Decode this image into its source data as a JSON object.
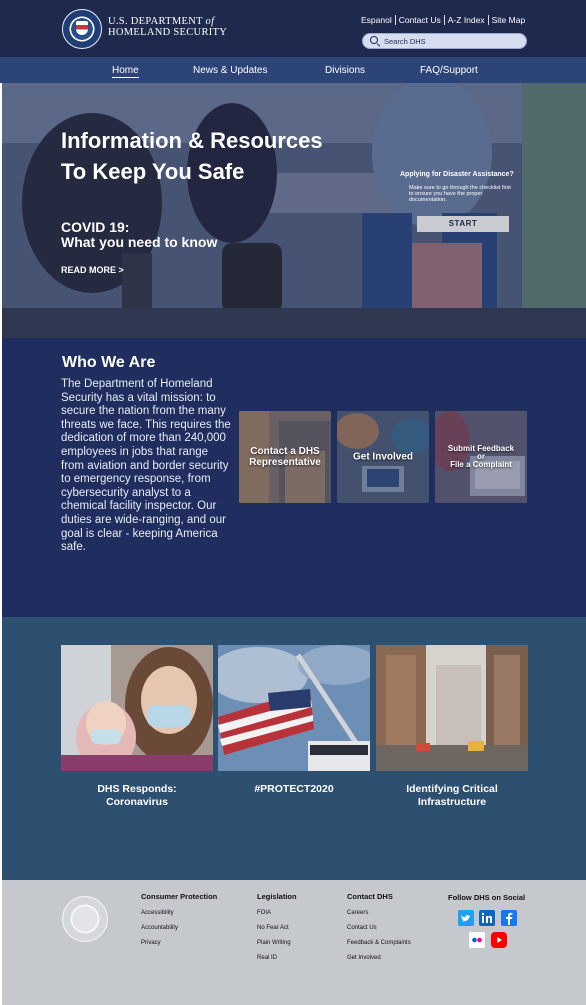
{
  "header": {
    "agency_line1": "U.S. DEPARTMENT",
    "agency_of": "of",
    "agency_line2": "HOMELAND SECURITY",
    "top_links": [
      "Espanol",
      "Contact Us",
      "A-Z Index",
      "Site Map"
    ],
    "search_placeholder": "Search DHS"
  },
  "nav": {
    "items": [
      "Home",
      "News & Updates",
      "Divisions",
      "FAQ/Support"
    ],
    "active": "Home"
  },
  "hero": {
    "title_line1": "Information & Resources",
    "title_line2": "To Keep You Safe",
    "covid_line1": "COVID 19:",
    "covid_line2": "What you need to know",
    "read_more": "READ MORE >",
    "assist_title": "Applying for Disaster Assistance?",
    "assist_body": "Make sure to go through the checklist first to ensure you have the proper documentation.",
    "start_label": "START"
  },
  "who": {
    "title": "Who We Are",
    "body": "The Department of Homeland Security has a vital mission: to secure the nation from the many threats we face.  This requires the dedication of more than 240,000 employees in jobs that range from aviation and border security to emergency response, from cybersecurity analyst to a chemical facility inspector.  Our duties are wide-ranging, and our goal is clear - keeping America safe.",
    "cards": [
      {
        "label_line1": "Contact a DHS",
        "label_line2": "Representative"
      },
      {
        "label_line1": "Get Involved"
      },
      {
        "label_line1": "Submit Feedback",
        "label_line2": "or",
        "label_line3": "File a Complaint"
      }
    ]
  },
  "stories": [
    {
      "label_line1": "DHS Responds:",
      "label_line2": "Coronavirus"
    },
    {
      "label_line1": "#PROTECT2020"
    },
    {
      "label_line1": "Identifying Critical",
      "label_line2": "Infrastructure"
    }
  ],
  "footer": {
    "columns": [
      {
        "title": "Consumer Protection",
        "links": [
          "Accessibility",
          "Accountability",
          "Privacy"
        ]
      },
      {
        "title": "Legislation",
        "links": [
          "FOIA",
          "No Fear Act",
          "Plain Writing",
          "Real ID"
        ]
      },
      {
        "title": "Contact DHS",
        "links": [
          "Careers",
          "Contact Us",
          "Feedback & Complaints",
          "Get Involved"
        ]
      }
    ],
    "social_title": "Follow DHS on Social",
    "social_icons": [
      "twitter-icon",
      "linkedin-icon",
      "facebook-icon",
      "flickr-icon",
      "youtube-icon"
    ]
  },
  "colors": {
    "header": "#1d2a4d",
    "nav": "#2d4478",
    "who_section": "#1f2e5e",
    "stories_section": "#2e5070",
    "footer": "#c5c8cc",
    "start_button": "#c9cbd0"
  }
}
